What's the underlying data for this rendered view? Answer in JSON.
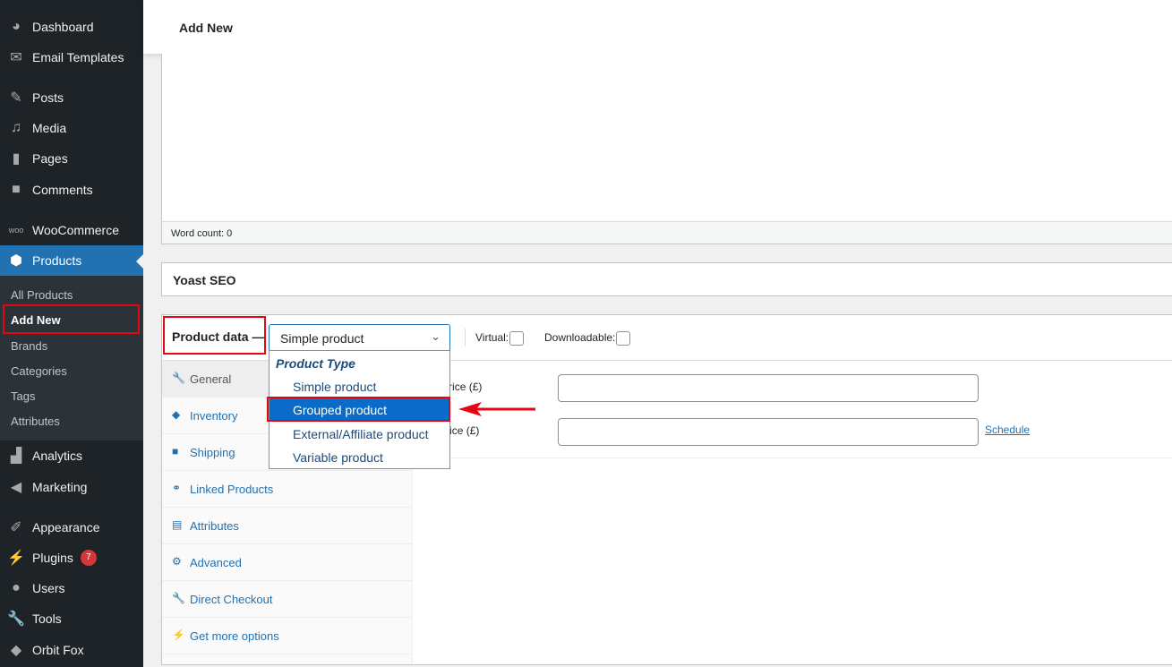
{
  "sidebar": {
    "items": [
      {
        "label": "Dashboard",
        "icon": "dashboard-icon"
      },
      {
        "label": "Email Templates",
        "icon": "email-icon"
      },
      {
        "label": "Posts",
        "icon": "pin-icon"
      },
      {
        "label": "Media",
        "icon": "media-icon"
      },
      {
        "label": "Pages",
        "icon": "pages-icon"
      },
      {
        "label": "Comments",
        "icon": "comment-icon"
      },
      {
        "label": "WooCommerce",
        "icon": "woo-icon"
      },
      {
        "label": "Products",
        "icon": "box-icon"
      },
      {
        "label": "Analytics",
        "icon": "bar-chart-icon"
      },
      {
        "label": "Marketing",
        "icon": "megaphone-icon"
      },
      {
        "label": "Appearance",
        "icon": "brush-icon"
      },
      {
        "label": "Plugins",
        "icon": "plug-icon",
        "badge": "7"
      },
      {
        "label": "Users",
        "icon": "user-icon"
      },
      {
        "label": "Tools",
        "icon": "wrench-icon"
      },
      {
        "label": "Orbit Fox",
        "icon": "fox-icon"
      }
    ],
    "submenu": [
      "All Products",
      "Add New",
      "Brands",
      "Categories",
      "Tags",
      "Attributes"
    ]
  },
  "header": {
    "title": "Add New"
  },
  "editor": {
    "word_count": "Word count: 0"
  },
  "yoast": {
    "title": "Yoast SEO"
  },
  "product_data": {
    "label": "Product data —",
    "type_selected": "Simple product",
    "virtual": "Virtual:",
    "downloadable": "Downloadable:",
    "tabs": [
      "General",
      "Inventory",
      "Shipping",
      "Linked Products",
      "Attributes",
      "Advanced",
      "Direct Checkout",
      "Get more options"
    ],
    "regular_price": "Regular price (£)",
    "sale_price": "Sale price (£)",
    "schedule": "Schedule",
    "dropdown": {
      "group": "Product Type",
      "options": [
        "Simple product",
        "Grouped product",
        "External/Affiliate product",
        "Variable product"
      ],
      "highlighted": "Grouped product"
    }
  },
  "colors": {
    "accent": "#2271b1",
    "highlight": "#e30613"
  }
}
